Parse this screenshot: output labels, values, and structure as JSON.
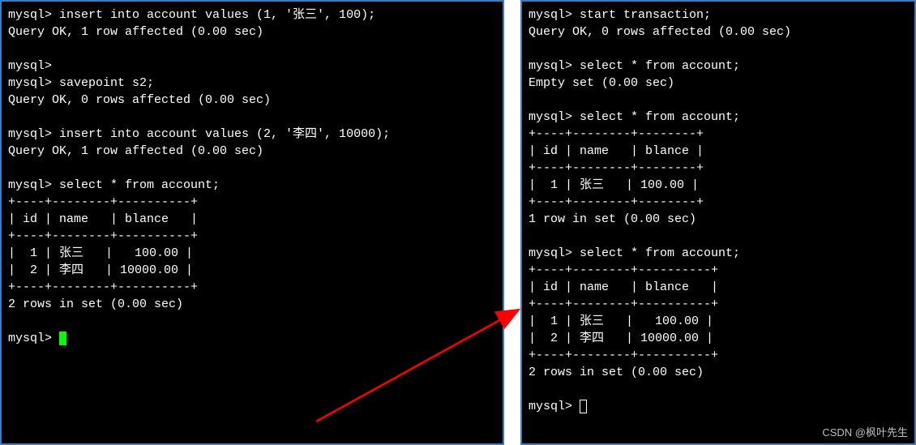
{
  "left": {
    "lines": [
      "mysql> insert into account values (1, '张三', 100);",
      "Query OK, 1 row affected (0.00 sec)",
      "",
      "mysql>",
      "mysql> savepoint s2;",
      "Query OK, 0 rows affected (0.00 sec)",
      "",
      "mysql> insert into account values (2, '李四', 10000);",
      "Query OK, 1 row affected (0.00 sec)",
      "",
      "mysql> select * from account;",
      "+----+--------+----------+",
      "| id | name   | blance   |",
      "+----+--------+----------+",
      "|  1 | 张三   |   100.00 |",
      "|  2 | 李四   | 10000.00 |",
      "+----+--------+----------+",
      "2 rows in set (0.00 sec)",
      "",
      "mysql> "
    ]
  },
  "right": {
    "lines": [
      "mysql> start transaction;",
      "Query OK, 0 rows affected (0.00 sec)",
      "",
      "mysql> select * from account;",
      "Empty set (0.00 sec)",
      "",
      "mysql> select * from account;",
      "+----+--------+--------+",
      "| id | name   | blance |",
      "+----+--------+--------+",
      "|  1 | 张三   | 100.00 |",
      "+----+--------+--------+",
      "1 row in set (0.00 sec)",
      "",
      "mysql> select * from account;",
      "+----+--------+----------+",
      "| id | name   | blance   |",
      "+----+--------+----------+",
      "|  1 | 张三   |   100.00 |",
      "|  2 | 李四   | 10000.00 |",
      "+----+--------+----------+",
      "2 rows in set (0.00 sec)",
      "",
      "mysql> "
    ]
  },
  "watermark": "CSDN @枫叶先生"
}
